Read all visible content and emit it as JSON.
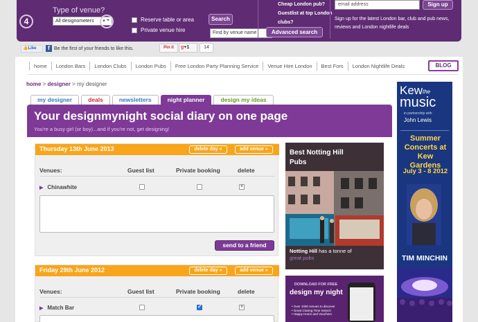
{
  "search": {
    "step4": "4",
    "step5": "5",
    "venue_type_label": "Type of venue?",
    "venue_type_value": "All designometers",
    "reserve_label": "Reserve table or area",
    "private_hire_label": "Private venue hire",
    "search_button": "Search",
    "find_placeholder": "Find by venue name",
    "cheap_pub": "Cheap London pub?",
    "guestlist": "Guestlist at top London",
    "clubs": "clubs?",
    "advanced_search": "Advanced search"
  },
  "newsletter": {
    "email_placeholder": "email address",
    "signup_button": "Sign up",
    "signup_text": "Sign up for the latest London bar, club and pub news, reviews and London nightlife deals"
  },
  "social": {
    "like": "Like",
    "fb_text": "Be the first of your friends to like this.",
    "pinit": "Pin it",
    "gplus": "+1",
    "gplus_count": "14"
  },
  "nav": {
    "items": [
      "home",
      "London Bars",
      "London Clubs",
      "London Pubs",
      "Free London Party Planning Service",
      "Venue Hire London",
      "Best Fors",
      "London Nightlife Deals"
    ],
    "blog": "BLOG"
  },
  "breadcrumb": {
    "home": "home",
    "sep1": " > ",
    "designer": "designer",
    "sep2": " > ",
    "current": "my designer"
  },
  "tabs": [
    {
      "label": "my designer",
      "color": "#3a7ab8"
    },
    {
      "label": "deals",
      "color": "#c8302e"
    },
    {
      "label": "newsletters",
      "color": "#3a7ab8"
    },
    {
      "label": "night planner",
      "color": "#ffffff"
    },
    {
      "label": "design my ideas",
      "color": "#6a9a2a"
    }
  ],
  "hero": {
    "title": "Your designmynight social diary on one page",
    "subtitle": "You're a busy girl (or boy)...and if you're not, get designing!"
  },
  "days": [
    {
      "date": "Thursday 13th June 2013",
      "delete_day": "delete day",
      "add_venue": "add venue",
      "col_venues": "Venues:",
      "col_guest": "Guest list",
      "col_private": "Private booking",
      "col_delete": "delete",
      "venue": "Chinawhite",
      "guest_checked": false,
      "private_checked": false,
      "send_button": "send to a friend"
    },
    {
      "date": "Friday 29th June 2012",
      "delete_day": "delete day",
      "add_venue": "add venue",
      "col_venues": "Venues:",
      "col_guest": "Guest list",
      "col_private": "Private booking",
      "col_delete": "delete",
      "venue": "Match Bar",
      "guest_checked": false,
      "private_checked": true
    }
  ],
  "promo": {
    "title_line1": "Best Notting Hill",
    "title_line2": "Pubs",
    "text_bold": "Notting Hill",
    "text_rest": " has a tonne of",
    "text_line2": "great pubs"
  },
  "app_ad": {
    "download": "DOWNLOAD FOR FREE",
    "logo": "design my night",
    "bullet1": "• Over 1000 venues to discover",
    "bullet2": "• Great Closing Time Search",
    "bullet3": "• Happy Hours and Vouchers"
  },
  "kew_ad": {
    "kew": "Kew",
    "the": "the",
    "music": "music",
    "partnership": "in partnership with",
    "sponsor": "John Lewis",
    "summer": "Summer Concerts at Kew Gardens",
    "dates": "July 3 - 8 2012",
    "artist": "TIM MINCHIN"
  },
  "colors": {
    "brand_purple": "#7e3a96",
    "dark_purple": "#5f2b73",
    "orange": "#f8a51b",
    "kew_blue": "#1a3680",
    "kew_yellow": "#ffd640"
  }
}
